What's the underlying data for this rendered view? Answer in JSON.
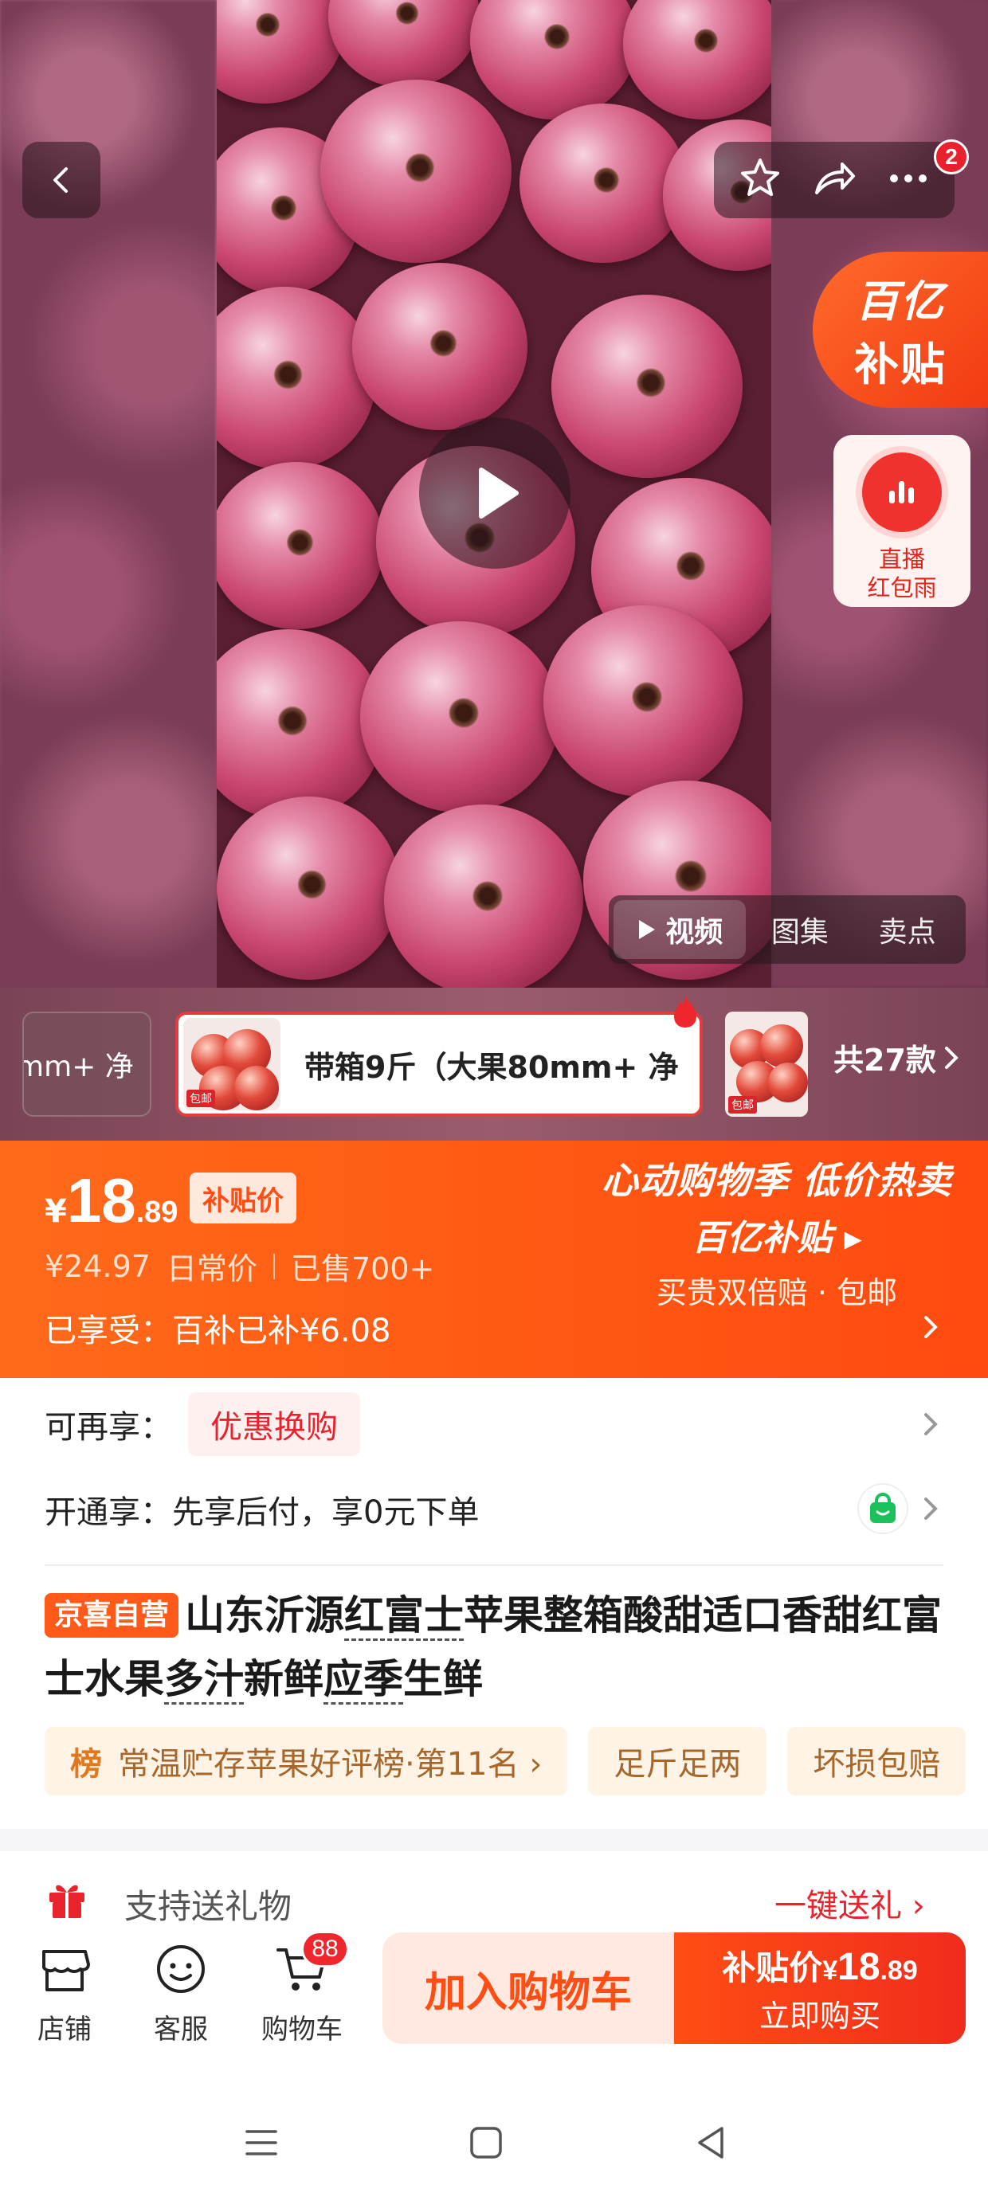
{
  "media": {
    "tabs": [
      {
        "label": "视频",
        "active": true,
        "icon": "play-triangle-icon"
      },
      {
        "label": "图集",
        "active": false
      },
      {
        "label": "卖点",
        "active": false
      }
    ],
    "cart_notification_count": "2"
  },
  "floating": {
    "subsidy_line1": "百亿",
    "subsidy_line2": "补贴",
    "live_line1": "直播",
    "live_line2": "红包雨"
  },
  "variants": {
    "prev_label": "mm+ 净",
    "active_label": "带箱9斤（大果80mm+ 净",
    "thumb_tag": "包邮",
    "count_label": "共27款"
  },
  "price": {
    "currency": "¥",
    "integer": "18",
    "decimal": ".89",
    "badge": "补贴价",
    "daily_price": "¥24.97",
    "daily_label": "日常价",
    "sold": "已售700+",
    "enjoyed": "已享受：百补已补¥6.08",
    "promo_line1": "心动购物季 低价热卖",
    "promo_line2": "百亿补贴 ▸",
    "promo_line3": "买贵双倍赔 · 包邮"
  },
  "benefits": {
    "more_label": "可再享：",
    "more_coupon": "优惠换购",
    "open_label": "开通享：先享后付，享0元下单"
  },
  "product": {
    "badge": "京喜自营",
    "title_parts": [
      "山东沂源",
      "红富士",
      "苹果整箱酸甜适口香甜红富士水果",
      "多汁",
      "新鲜",
      "应季",
      "生鲜"
    ],
    "tags": [
      {
        "prefix": "榜",
        "text": "常温贮存苹果好评榜·第11名 ›"
      },
      {
        "prefix": "",
        "text": "足斤足两"
      },
      {
        "prefix": "",
        "text": "坏损包赔"
      }
    ]
  },
  "gift": {
    "label": "支持送礼物",
    "action": "一键送礼 ›"
  },
  "bottom_bar": {
    "store": "店铺",
    "service": "客服",
    "cart": "购物车",
    "cart_count": "88",
    "add_to_cart": "加入购物车",
    "buy_prefix": "补贴价",
    "buy_currency": "¥",
    "buy_int": "18",
    "buy_dec": ".89",
    "buy_now": "立即购买"
  },
  "colors": {
    "accent": "#ff5a14",
    "red": "#e8232d",
    "tag_bg": "#fff3e6"
  }
}
